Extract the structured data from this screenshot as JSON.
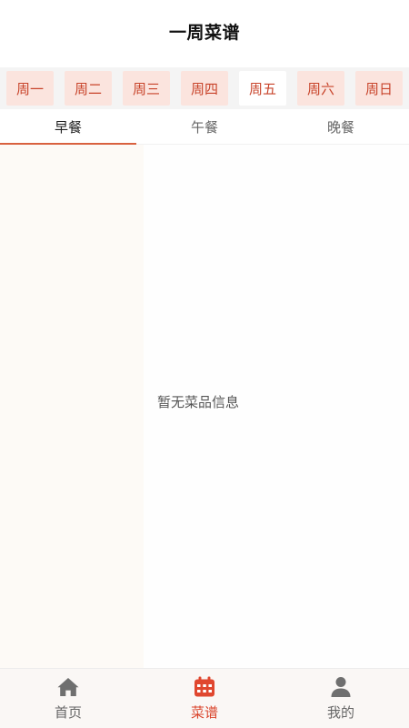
{
  "header": {
    "title": "一周菜谱"
  },
  "days": [
    {
      "label": "周一",
      "active": false
    },
    {
      "label": "周二",
      "active": false
    },
    {
      "label": "周三",
      "active": false
    },
    {
      "label": "周四",
      "active": false
    },
    {
      "label": "周五",
      "active": true
    },
    {
      "label": "周六",
      "active": false
    },
    {
      "label": "周日",
      "active": false
    }
  ],
  "meals": [
    {
      "label": "早餐",
      "active": true
    },
    {
      "label": "午餐",
      "active": false
    },
    {
      "label": "晚餐",
      "active": false
    }
  ],
  "content": {
    "empty_text": "暂无菜品信息"
  },
  "tabbar": {
    "items": [
      {
        "label": "首页",
        "icon": "home-icon",
        "active": false
      },
      {
        "label": "菜谱",
        "icon": "calendar-icon",
        "active": true
      },
      {
        "label": "我的",
        "icon": "user-icon",
        "active": false
      }
    ]
  },
  "colors": {
    "accent": "#d9432a",
    "day_bg": "#fbe4de",
    "day_text": "#c8432a"
  }
}
